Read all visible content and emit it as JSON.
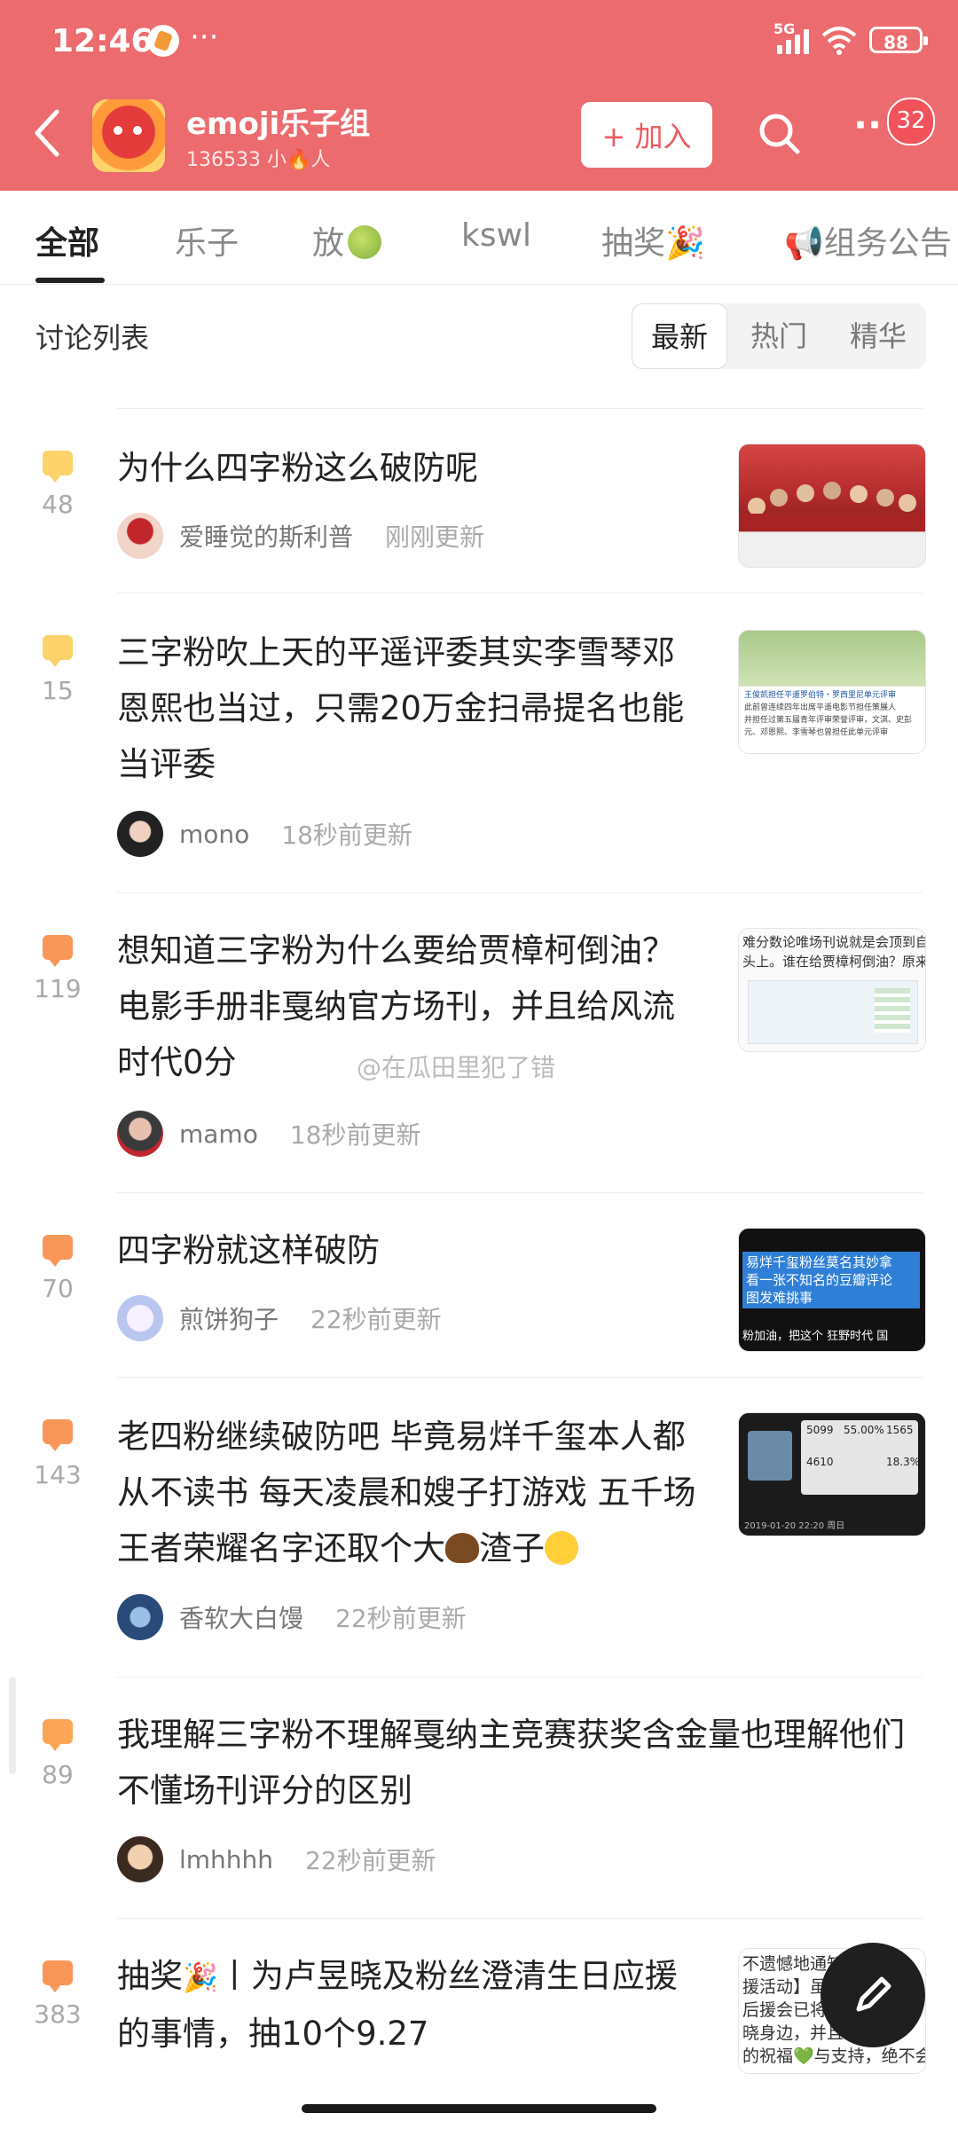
{
  "status_bar": {
    "time": "12:46",
    "dots": "···",
    "network": "5G",
    "battery": "88"
  },
  "header": {
    "group_name": "emoji乐子组",
    "member_count_prefix": "136533 小",
    "member_count_suffix": "人",
    "join_label": "+ 加入",
    "notification_badge": "32"
  },
  "tabs": [
    {
      "label": "全部",
      "active": true
    },
    {
      "label": "乐子"
    },
    {
      "label": "放"
    },
    {
      "label": "kswl"
    },
    {
      "label": "抽奖🎉"
    },
    {
      "label": "📢组务公告"
    }
  ],
  "list": {
    "title": "讨论列表",
    "sort_options": [
      "最新",
      "热门",
      "精华"
    ],
    "selected_sort": "最新"
  },
  "posts": [
    {
      "count": "48",
      "title": "为什么四字粉这么破防呢",
      "user": "爱睡觉的斯利普",
      "time": "刚刚更新",
      "icon_color": "yellow"
    },
    {
      "count": "15",
      "title": "三字粉吹上天的平遥评委其实李雪琴邓恩熙也当过，只需20万金扫帚提名也能当评委",
      "user": "mono",
      "time": "18秒前更新",
      "icon_color": "yellow"
    },
    {
      "count": "119",
      "title": "想知道三字粉为什么要给贾樟柯倒油？电影手册非戛纳官方场刊，并且给风流时代0分",
      "user": "mamo",
      "time": "18秒前更新",
      "icon_color": "orange"
    },
    {
      "count": "70",
      "title": "四字粉就这样破防",
      "user": "煎饼狗子",
      "time": "22秒前更新",
      "icon_color": "orange"
    },
    {
      "count": "143",
      "title_part1": "老四粉继续破防吧 毕竟易烊千玺本人都从不读书 每天凌晨和嫂子打游戏 五千场王者荣耀名字还取个大",
      "title_part2": "渣子",
      "user": "香软大白馒",
      "time": "22秒前更新",
      "icon_color": "orange"
    },
    {
      "count": "89",
      "title": "我理解三字粉不理解戛纳主竞赛获奖含金量也理解他们不懂场刊评分的区别",
      "user": "lmhhhh",
      "time": "22秒前更新",
      "icon_color": "orange"
    },
    {
      "count": "383",
      "title_part1": "抽奖",
      "title_part2": "丨为卢昱晓及粉丝澄清生日应援的事情，抽10个9.27",
      "icon_color": "orange"
    }
  ],
  "thumbnails": {
    "post2_line1": "王俊凯担任平遥罗伯特・罗西里尼单元评审",
    "post2_line2": "此前曾连续四年出席平遥电影节担任策展人",
    "post2_line3": "并担任过第五届青年评审荣誉评审，文淇、史彭元、邓恩熙、李雪琴也曾担任此单元评审",
    "post3_line1": "难分数论唯场刊说就是会顶到自",
    "post3_line2": "头上。谁在给贾樟柯倒油？原来是",
    "post4_line1": "易烊千玺粉丝莫名其妙拿",
    "post4_line2": "看一张不知名的豆瓣评论",
    "post4_line3": "图发难挑事",
    "post4_line4": "粉加油，把这个 狂野时代 国",
    "post5_stats": [
      "5099",
      "55.00%",
      "1565",
      "4610",
      "18.3%"
    ],
    "post5_date": "2019-01-20 22:20 周日",
    "post7_line1": "不遗憾地通知",
    "post7_line2": "援活动】虽",
    "post7_line3": "后援会已将",
    "post7_line4": "晓身边，并且",
    "post7_line5": "的祝福💚与支持，绝不会"
  },
  "watermark": "@在瓜田里犯了错",
  "colors": {
    "header_bg": "#ec6b6e",
    "accent": "#ec5a62",
    "comment_yellow": "#fbd36a",
    "comment_orange": "#f99758"
  },
  "icons": [
    "back-arrow-icon",
    "search-icon",
    "more-icon",
    "comment-icon",
    "edit-pen-icon",
    "fire-icon",
    "melon-icon"
  ]
}
